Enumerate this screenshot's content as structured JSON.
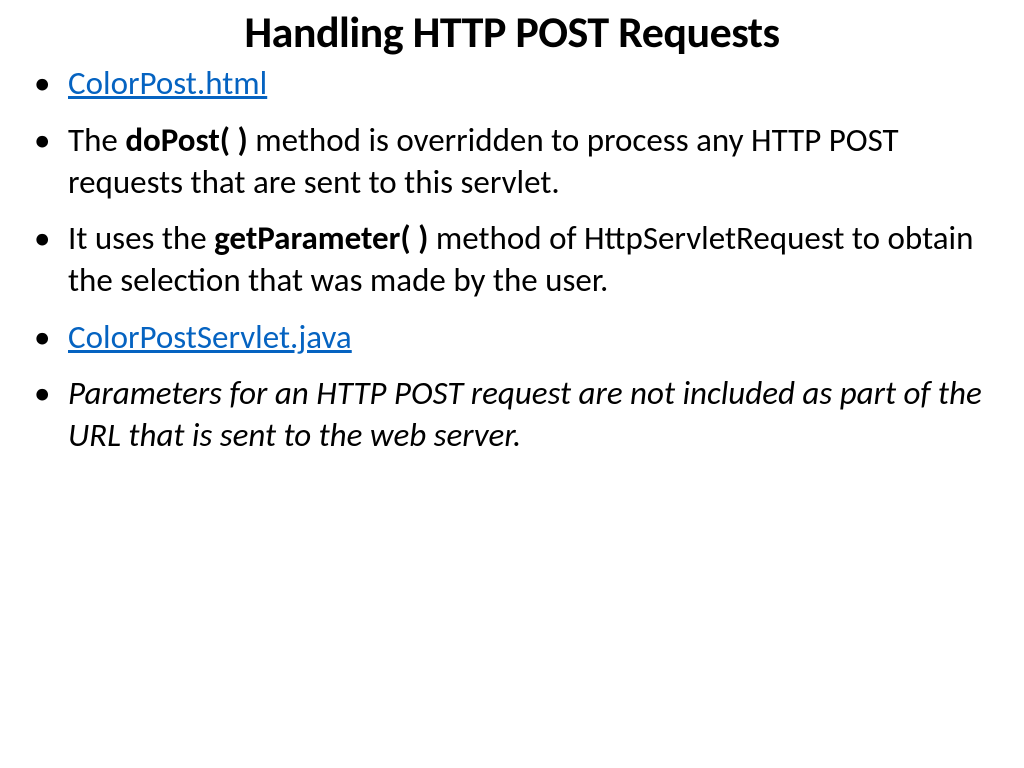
{
  "title": "Handling HTTP POST Requests",
  "bullets": {
    "b0": {
      "link_text": "ColorPost.html"
    },
    "b1": {
      "pre": "The ",
      "bold": "doPost( )",
      "post": " method is overridden to process any HTTP POST requests that are sent to this servlet."
    },
    "b2": {
      "pre": "It uses the ",
      "bold": "getParameter( )",
      "post": " method of HttpServletRequest to obtain the selection that was made by the user."
    },
    "b3": {
      "link_text": "ColorPostServlet.java"
    },
    "b4": {
      "italic_text": "Parameters for an HTTP POST request are not included as part of the URL that is sent to the web server."
    }
  }
}
